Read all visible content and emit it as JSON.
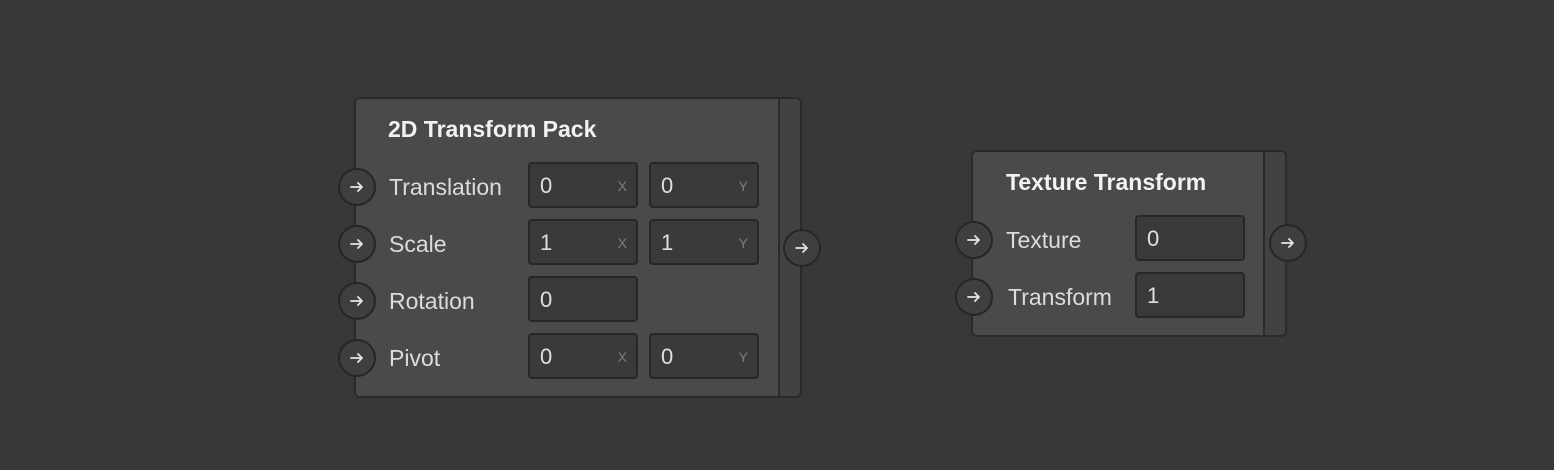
{
  "nodes": {
    "transform_pack": {
      "title": "2D Transform Pack",
      "params": {
        "translation": {
          "label": "Translation",
          "x": "0",
          "y": "0"
        },
        "scale": {
          "label": "Scale",
          "x": "1",
          "y": "1"
        },
        "rotation": {
          "label": "Rotation",
          "value": "0"
        },
        "pivot": {
          "label": "Pivot",
          "x": "0",
          "y": "0"
        }
      }
    },
    "texture_transform": {
      "title": "Texture Transform",
      "params": {
        "texture": {
          "label": "Texture",
          "value": "0"
        },
        "transform": {
          "label": "Transform",
          "value": "1"
        }
      }
    }
  },
  "axis_labels": {
    "x": "X",
    "y": "Y"
  },
  "icons": {
    "port": "arrow-right-icon"
  },
  "colors": {
    "background": "#383838",
    "node_body": "#4a4a4a",
    "field_bg": "#3a3a3a",
    "text": "#e6e6e6"
  }
}
